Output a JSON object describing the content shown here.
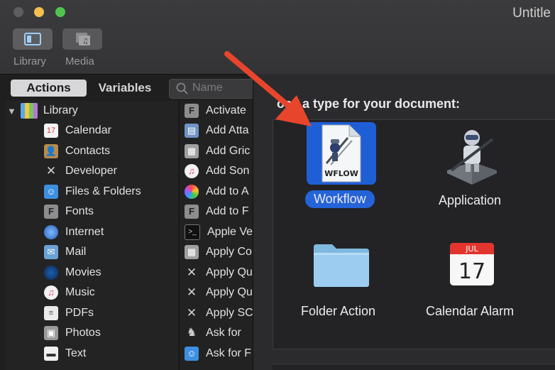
{
  "window": {
    "title": "Untitle"
  },
  "toolbar": {
    "library_label": "Library",
    "media_label": "Media"
  },
  "tabs": {
    "actions": "Actions",
    "variables": "Variables"
  },
  "search": {
    "placeholder": "Name"
  },
  "library": {
    "root": "Library",
    "items": [
      {
        "label": "Calendar",
        "icon": "calendar-icon"
      },
      {
        "label": "Contacts",
        "icon": "contacts-icon"
      },
      {
        "label": "Developer",
        "icon": "developer-icon"
      },
      {
        "label": "Files & Folders",
        "icon": "finder-icon"
      },
      {
        "label": "Fonts",
        "icon": "fonts-icon"
      },
      {
        "label": "Internet",
        "icon": "globe-icon"
      },
      {
        "label": "Mail",
        "icon": "mail-icon"
      },
      {
        "label": "Movies",
        "icon": "movies-icon"
      },
      {
        "label": "Music",
        "icon": "music-icon"
      },
      {
        "label": "PDFs",
        "icon": "pdf-icon"
      },
      {
        "label": "Photos",
        "icon": "photos-icon"
      },
      {
        "label": "Text",
        "icon": "text-icon"
      }
    ]
  },
  "actions": {
    "items": [
      {
        "label": "Activate",
        "icon": "font-book-icon"
      },
      {
        "label": "Add Atta",
        "icon": "preview-icon"
      },
      {
        "label": "Add Gric",
        "icon": "image-icon"
      },
      {
        "label": "Add Son",
        "icon": "music-icon"
      },
      {
        "label": "Add to A",
        "icon": "photos-icon"
      },
      {
        "label": "Add to F",
        "icon": "font-book-icon"
      },
      {
        "label": "Apple Ve",
        "icon": "terminal-icon"
      },
      {
        "label": "Apply Co",
        "icon": "image-icon"
      },
      {
        "label": "Apply Qu",
        "icon": "tools-icon"
      },
      {
        "label": "Apply Qu",
        "icon": "tools-icon"
      },
      {
        "label": "Apply SC",
        "icon": "tools-icon"
      },
      {
        "label": "Ask for",
        "icon": "automator-icon"
      },
      {
        "label": "Ask for F",
        "icon": "finder-icon"
      }
    ]
  },
  "dialog": {
    "prompt": "ose a type for your document:",
    "types": [
      {
        "label": "Workflow",
        "icon": "workflow-document-icon",
        "badge": "WFLOW",
        "selected": true
      },
      {
        "label": "Application",
        "icon": "automator-robot-icon"
      },
      {
        "label": "Folder Action",
        "icon": "folder-icon"
      },
      {
        "label": "Calendar Alarm",
        "icon": "calendar-alarm-icon",
        "month": "JUL",
        "day": "17"
      }
    ]
  },
  "annotation": {
    "arrow_color": "#e8452d"
  },
  "colors": {
    "selection_blue": "#2563d8",
    "toolbar_bg": "#3b3b3d",
    "panel_bg": "#232324"
  }
}
